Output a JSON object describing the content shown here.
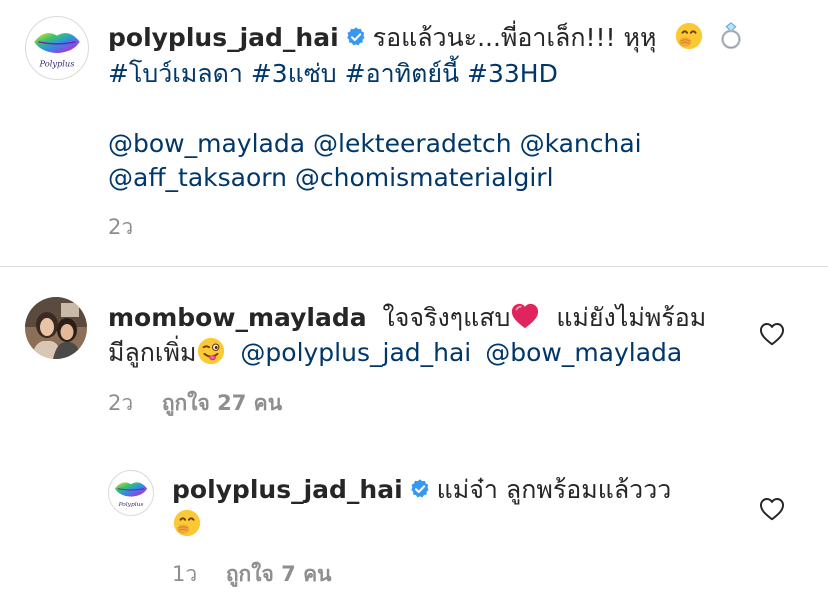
{
  "caption": {
    "username": "polyplus_jad_hai",
    "text": "รอแล้วนะ...พี่อาเล็ก!!! หุหุ",
    "avatar_text": "Polyplus",
    "hashtags": [
      "#โบว์เมลดา",
      "#3แซ่บ",
      "#อาทิตย์นี้",
      "#33HD"
    ],
    "mentions_line1": [
      "@bow_maylada",
      "@lekteeradetch",
      "@kanchai"
    ],
    "mentions_line2": [
      "@aff_taksaorn",
      "@chomismaterialgirl"
    ],
    "time": "2ว"
  },
  "comment": {
    "username": "mombow_maylada",
    "text_line1": "ใจจริงๆแสบ",
    "text_line1_after": "แม่ยังไม่พร้อม",
    "text_line2": "มีลูกเพิ่ม",
    "mentions": [
      "@polyplus_jad_hai",
      "@bow_maylada"
    ],
    "time": "2ว",
    "likes": "ถูกใจ 27 คน"
  },
  "reply": {
    "username": "polyplus_jad_hai",
    "text": "แม่จ๋า ลูกพร้อมแล้ววว",
    "avatar_text": "Polyplus",
    "time": "1ว",
    "likes": "ถูกใจ 7 คน"
  },
  "colors": {
    "link": "#00376b",
    "verified": "#3897f0",
    "meta": "#8e8e8e",
    "heart_red": "#e0245e"
  },
  "icons": [
    "verified-badge-icon",
    "smirk-face-icon",
    "ring-icon",
    "heart-emoji",
    "wink-tongue-emoji",
    "heart-outline-icon"
  ]
}
